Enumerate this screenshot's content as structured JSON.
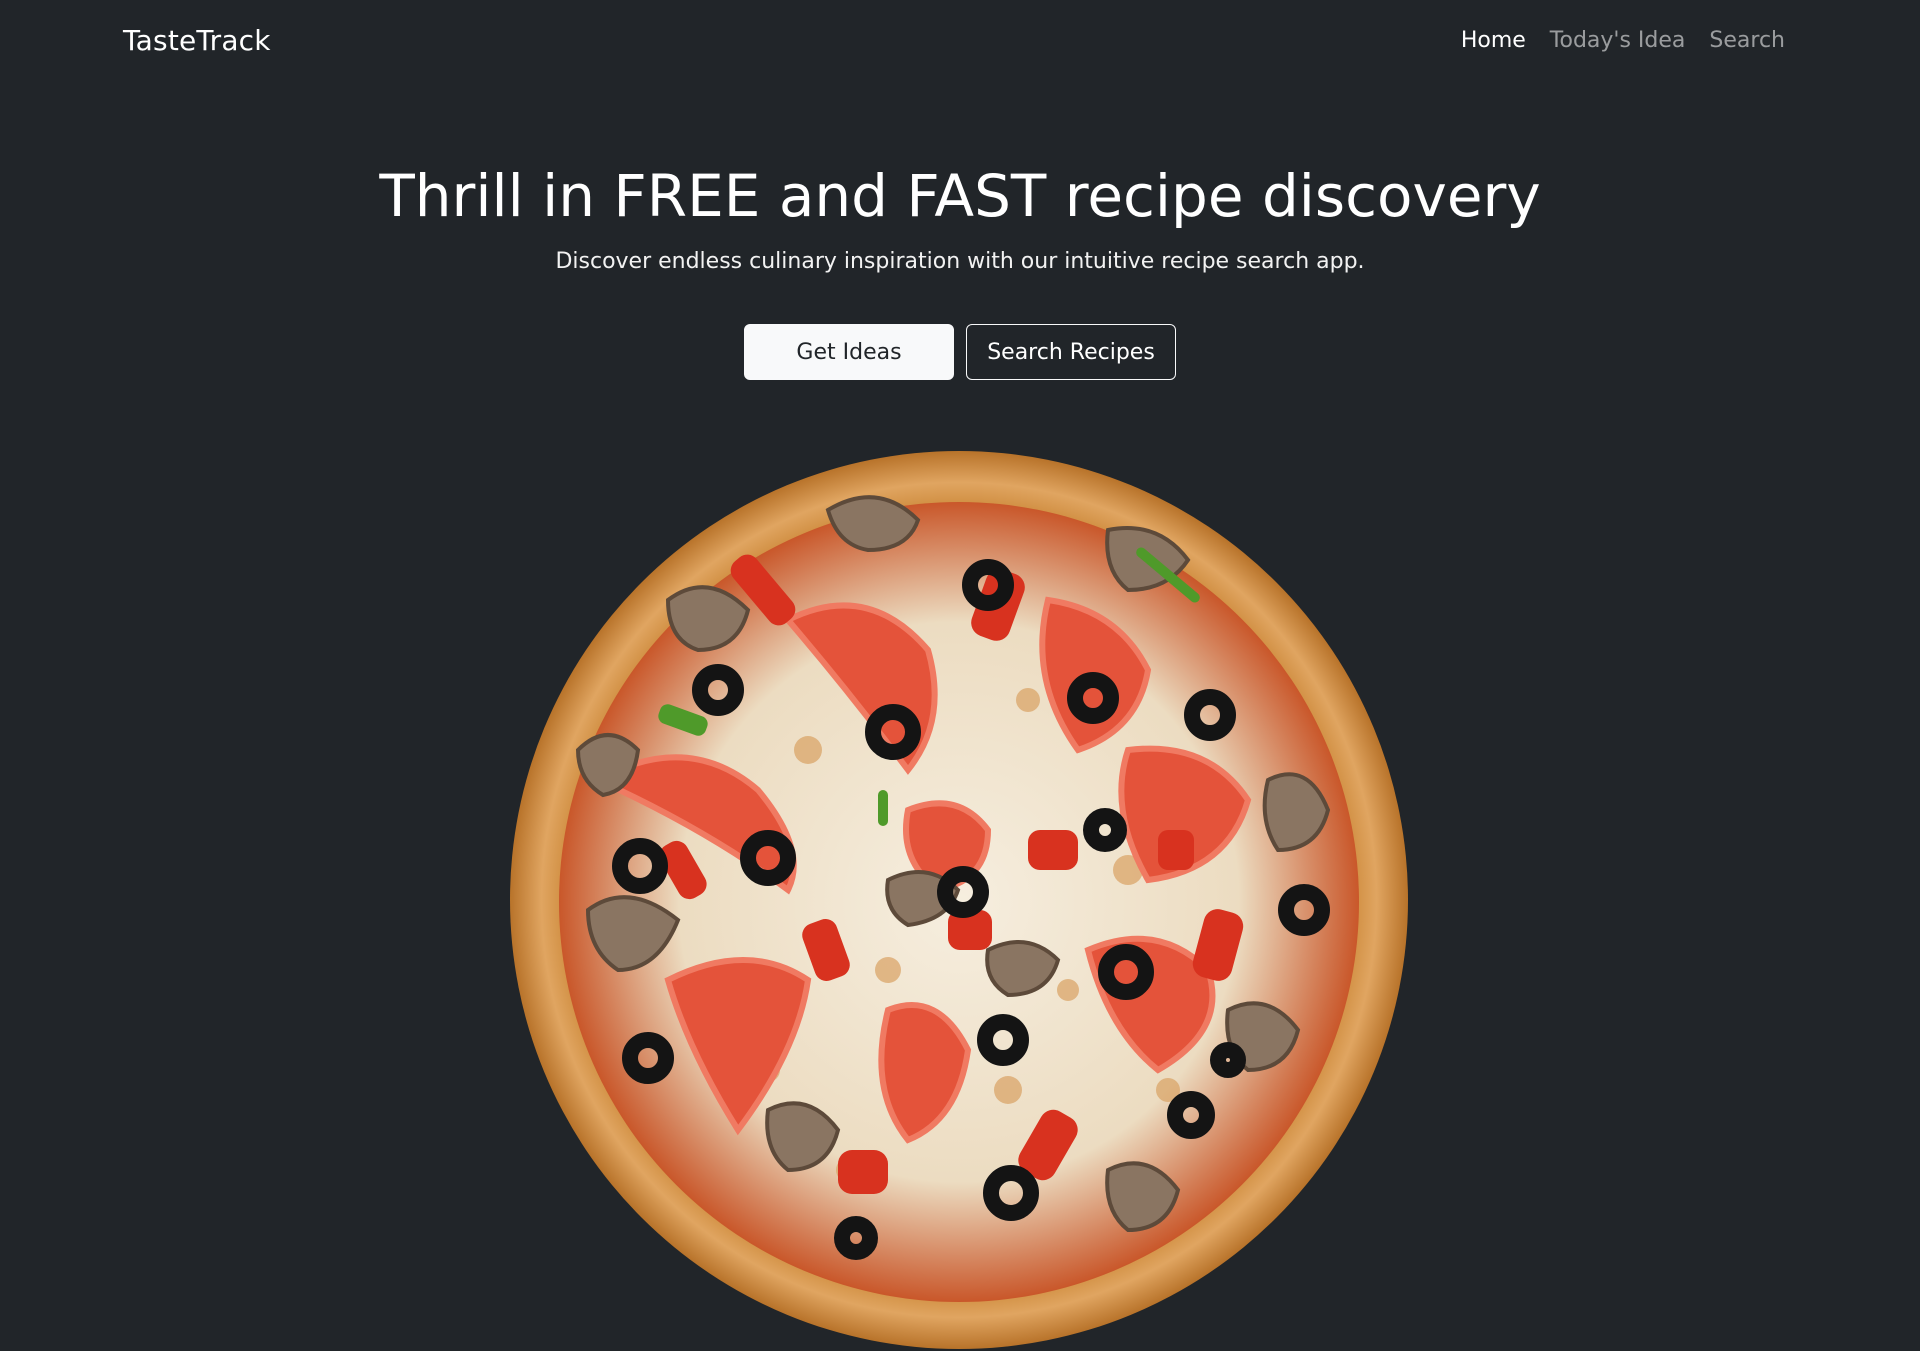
{
  "nav": {
    "brand": "TasteTrack",
    "links": [
      {
        "label": "Home",
        "active": true
      },
      {
        "label": "Today's Idea",
        "active": false
      },
      {
        "label": "Search",
        "active": false
      }
    ]
  },
  "hero": {
    "title": "Thrill in FREE and FAST recipe discovery",
    "lead": "Discover endless culinary inspiration with our intuitive recipe search app.",
    "primary_button": "Get Ideas",
    "secondary_button": "Search Recipes"
  },
  "hero_image": {
    "subject": "pizza-image"
  },
  "colors": {
    "background": "#212529",
    "text": "#ffffff",
    "muted_link": "rgba(255,255,255,0.55)",
    "button_light": "#f8f9fa"
  }
}
